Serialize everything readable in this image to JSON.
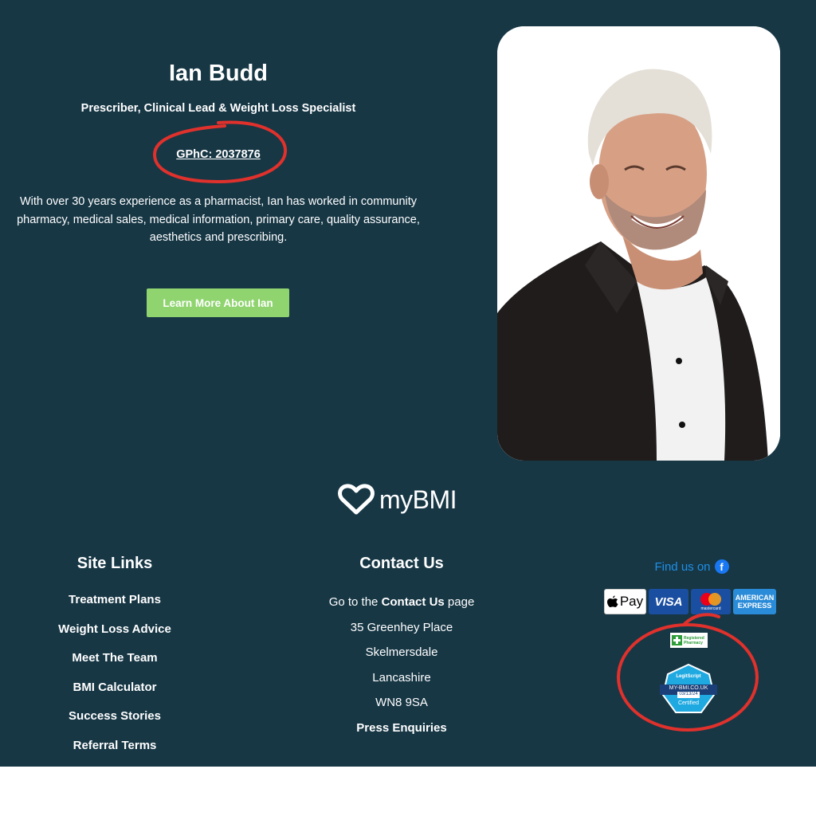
{
  "profile": {
    "name": "Ian Budd",
    "role": "Prescriber, Clinical Lead & Weight Loss Specialist",
    "gphc": "GPhC: 2037876",
    "bio": "With over 30 years experience as a pharmacist, Ian has worked in community pharmacy, medical sales, medical information, primary care, quality assurance, aesthetics and prescribing.",
    "cta_label": "Learn More About Ian"
  },
  "logo": {
    "wordmark": "myBMI"
  },
  "site_links": {
    "heading": "Site Links",
    "items": [
      "Treatment Plans",
      "Weight Loss Advice",
      "Meet The Team",
      "BMI Calculator",
      "Success Stories",
      "Referral Terms"
    ]
  },
  "contact": {
    "heading": "Contact Us",
    "go_to_prefix": "Go to the ",
    "go_to_link": "Contact Us",
    "go_to_suffix": " page",
    "address": [
      "35 Greenhey Place",
      "Skelmersdale",
      "Lancashire",
      "WN8 9SA"
    ],
    "press": "Press Enquiries"
  },
  "social": {
    "find_us": "Find us on",
    "icon": "facebook-icon"
  },
  "payments": {
    "apple_pay": "Pay",
    "visa": "VISA",
    "mastercard": "mastercard",
    "amex": [
      "AMERICAN",
      "EXPRESS"
    ]
  },
  "badges": {
    "registered_pharmacy": [
      "Registered",
      "Pharmacy"
    ],
    "legitscript": {
      "brand": "LegitScript",
      "domain": "MY-BMI.CO.UK",
      "date": "03/13/24",
      "status": "Certified"
    }
  },
  "colors": {
    "background": "#173745",
    "cta": "#8fd46f",
    "annotation": "#e0312c",
    "link_blue": "#1e90e8"
  }
}
